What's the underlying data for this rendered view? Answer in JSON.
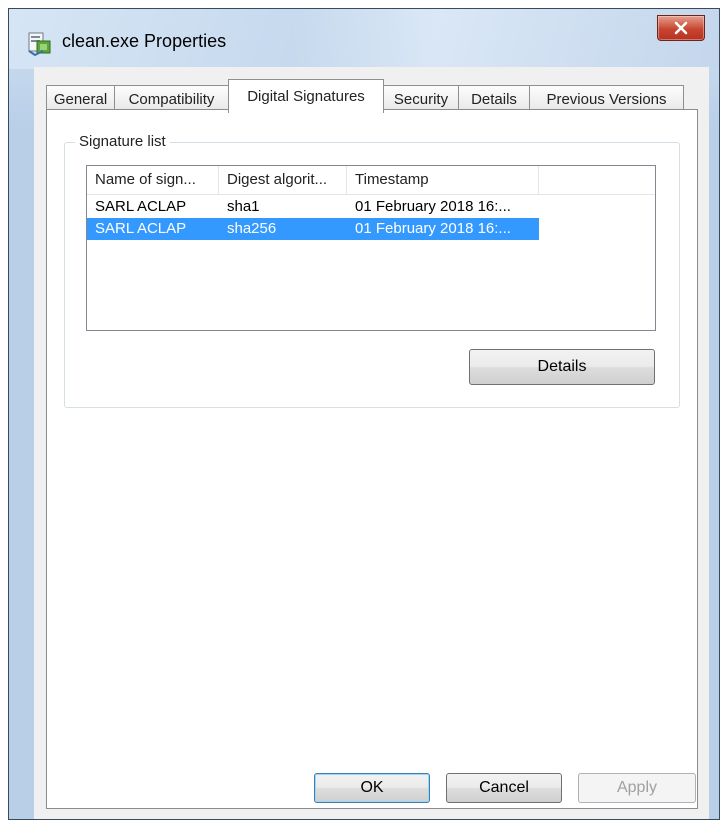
{
  "window": {
    "title": "clean.exe Properties",
    "close_glyph": "X"
  },
  "tabs": [
    {
      "label": "General"
    },
    {
      "label": "Compatibility"
    },
    {
      "label": "Digital Signatures",
      "active": true
    },
    {
      "label": "Security"
    },
    {
      "label": "Details"
    },
    {
      "label": "Previous Versions"
    }
  ],
  "signature_list": {
    "group_label": "Signature list",
    "columns": [
      "Name of sign...",
      "Digest algorit...",
      "Timestamp"
    ],
    "rows": [
      {
        "name": "SARL ACLAP",
        "digest": "sha1",
        "timestamp": "01 February 2018 16:...",
        "selected": false
      },
      {
        "name": "SARL ACLAP",
        "digest": "sha256",
        "timestamp": "01 February 2018 16:...",
        "selected": true
      }
    ],
    "details_button": "Details"
  },
  "buttons": {
    "ok": "OK",
    "cancel": "Cancel",
    "apply": "Apply"
  },
  "colors": {
    "selection": "#3399ff",
    "close_button": "#c74530"
  },
  "icons": {
    "title": "properties-file-icon",
    "close": "close-icon"
  }
}
